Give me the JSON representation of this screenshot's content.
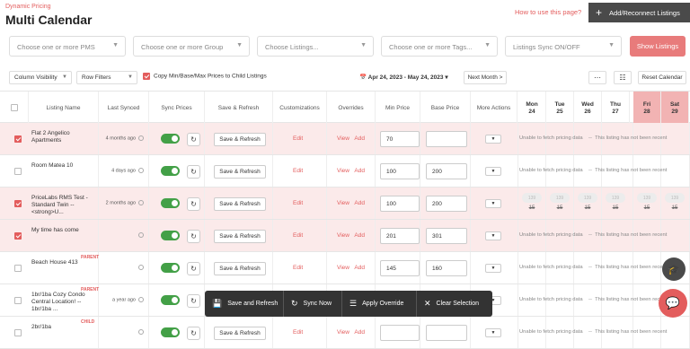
{
  "header": {
    "brand": "Dynamic Pricing",
    "title": "Multi Calendar",
    "how_to": "How to use this page?",
    "add_button": "Add/Reconnect Listings"
  },
  "filters": {
    "pms": "Choose one or more PMS",
    "group": "Choose one or more Group",
    "listings": "Choose Listings...",
    "tags": "Choose one or more Tags...",
    "sync": "Listings Sync ON/OFF",
    "show_button": "Show Listings"
  },
  "toolbar": {
    "column_visibility": "Column Visibility",
    "row_filters": "Row Filters",
    "copy_label": "Copy Min/Base/Max Prices to Child Listings",
    "date_range": "Apr 24, 2023 - May 24, 2023",
    "next_month": "Next Month >",
    "reset_calendar": "Reset Calendar"
  },
  "columns": {
    "listing_name": "Listing Name",
    "last_synced": "Last Synced",
    "sync_prices": "Sync Prices",
    "save_refresh": "Save & Refresh",
    "customizations": "Customizations",
    "overrides": "Overrides",
    "min_price": "Min Price",
    "base_price": "Base Price",
    "more_actions": "More Actions"
  },
  "days": [
    {
      "dow": "Mon",
      "date": "24",
      "weekend": false
    },
    {
      "dow": "Tue",
      "date": "25",
      "weekend": false
    },
    {
      "dow": "Wed",
      "date": "26",
      "weekend": false
    },
    {
      "dow": "Thu",
      "date": "27",
      "weekend": false
    },
    {
      "dow": "Fri",
      "date": "28",
      "weekend": true
    },
    {
      "dow": "Sat",
      "date": "29",
      "weekend": true
    }
  ],
  "row_labels": {
    "save_refresh": "Save & Refresh",
    "edit": "Edit",
    "view": "View",
    "add": "Add",
    "parent": "PARENT",
    "child": "CHILD",
    "unable": "Unable to fetch pricing data",
    "not_recent": "This listing has not been recent"
  },
  "rows": [
    {
      "name": "Flat 2 Angelico Apartments",
      "synced": "4 months ago",
      "checked": true,
      "tag": "",
      "min": "70",
      "base": "",
      "state": "unable"
    },
    {
      "name": "Room Matea 10",
      "synced": "4 days ago",
      "checked": false,
      "tag": "",
      "min": "100",
      "base": "200",
      "state": "unable"
    },
    {
      "name": "PriceLabs RMS Test - Standard Twin -- <strong>U...",
      "synced": "2 months ago",
      "checked": true,
      "tag": "",
      "min": "100",
      "base": "200",
      "state": "prices"
    },
    {
      "name": "My time has come",
      "synced": "",
      "checked": true,
      "tag": "",
      "min": "201",
      "base": "301",
      "state": "unable"
    },
    {
      "name": "Beach House 413",
      "synced": "",
      "checked": false,
      "tag": "PARENT",
      "min": "145",
      "base": "160",
      "state": "unable"
    },
    {
      "name": "1br/1ba Cozy Condo Central Location! -- 1br/1ba ...",
      "synced": "a year ago",
      "checked": false,
      "tag": "PARENT",
      "min": "",
      "base": "",
      "state": "unable"
    },
    {
      "name": "2br/1ba",
      "synced": "",
      "checked": false,
      "tag": "CHILD",
      "min": "",
      "base": "",
      "state": "unable"
    }
  ],
  "price_pills": {
    "top": "139",
    "bottom": "15"
  },
  "bulk": {
    "save": "Save and Refresh",
    "sync": "Sync Now",
    "override": "Apply Override",
    "clear": "Clear Selection"
  }
}
